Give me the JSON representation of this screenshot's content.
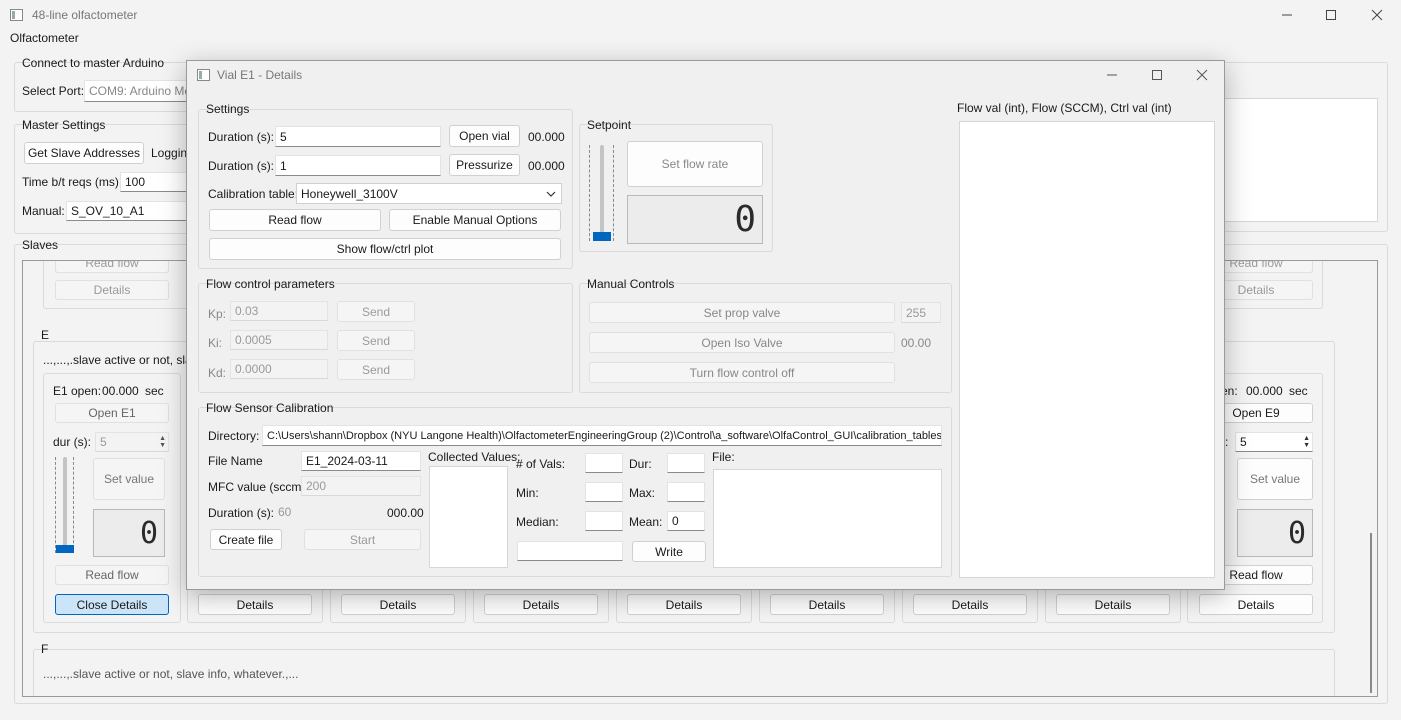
{
  "main_window": {
    "title": "48-line olfactometer",
    "menu": "Olfactometer",
    "connect": {
      "title": "Connect to master Arduino",
      "port_label": "Select Port:",
      "port_value": "COM9: Arduino Mega"
    },
    "master_settings": {
      "title": "Master Settings",
      "get_slave_button": "Get Slave Addresses",
      "logging_label": "Logging",
      "time_label": "Time b/t reqs (ms):",
      "time_value": "100",
      "manual_label": "Manual:",
      "manual_value": "S_OV_10_A1"
    },
    "slaves": {
      "title": "Slaves",
      "top_row": {
        "read_flow": "Read flow",
        "details": "Details"
      },
      "e_group": {
        "title": "E",
        "info": "...,...,.slave active or not, sla",
        "vial_e1": {
          "open_label": "E1 open:",
          "open_value": "00.000",
          "open_unit": "sec",
          "open_button": "Open E1",
          "dur_label": "dur (s):",
          "dur_value": "5",
          "set_value": "Set value",
          "lcd": "0",
          "read_flow": "Read flow",
          "close_details": "Close Details"
        },
        "vial_e9": {
          "open_label": "en:",
          "open_value": "00.000",
          "open_unit": "sec",
          "open_button": "Open E9",
          "dur_label": "):",
          "dur_value": "5",
          "set_value": "Set value",
          "lcd": "0",
          "read_flow": "Read flow",
          "details": "Details"
        },
        "details_buttons": [
          "Details",
          "Details",
          "Details",
          "Details",
          "Details",
          "Details",
          "Details"
        ]
      },
      "f_group": {
        "title": "F",
        "info": "...,...,.slave active or not, slave info, whatever.,..."
      }
    }
  },
  "dialog": {
    "title": "Vial E1 - Details",
    "settings": {
      "title": "Settings",
      "duration_label_1": "Duration (s):",
      "duration_value_1": "5",
      "open_vial_button": "Open vial",
      "open_vial_time": "00.000",
      "duration_label_2": "Duration (s):",
      "duration_value_2": "1",
      "pressurize_button": "Pressurize",
      "pressurize_time": "00.000",
      "calibration_label": "Calibration table:",
      "calibration_value": "Honeywell_3100V",
      "read_flow_button": "Read flow",
      "enable_manual_button": "Enable Manual Options",
      "show_plot_button": "Show flow/ctrl plot"
    },
    "setpoint": {
      "title": "Setpoint",
      "set_flow_button": "Set flow rate",
      "lcd": "0"
    },
    "plot": {
      "title": "Flow val (int), Flow (SCCM), Ctrl val (int)"
    },
    "flow_control": {
      "title": "Flow control parameters",
      "kp_label": "Kp:",
      "kp_value": "0.03",
      "ki_label": "Ki:",
      "ki_value": "0.0005",
      "kd_label": "Kd:",
      "kd_value": "0.0000",
      "send": "Send"
    },
    "manual_controls": {
      "title": "Manual Controls",
      "set_prop_button": "Set prop valve",
      "prop_value": "255",
      "open_iso_button": "Open Iso Valve",
      "iso_value": "00.00",
      "turn_off_button": "Turn flow control off"
    },
    "calibration": {
      "title": "Flow Sensor Calibration",
      "directory_label": "Directory:",
      "directory_value": "C:\\Users\\shann\\Dropbox (NYU Langone Health)\\OlfactometerEngineeringGroup (2)\\Control\\a_software\\OlfaControl_GUI\\calibration_tables",
      "file_name_label": "File Name",
      "file_name_value": "E1_2024-03-11",
      "mfc_label": "MFC value (sccm):",
      "mfc_value": "200",
      "duration_label": "Duration (s):",
      "duration_value": "60",
      "duration_time": "000.00",
      "create_file": "Create file",
      "start": "Start",
      "collected_label": "Collected Values:",
      "num_vals_label": "# of Vals:",
      "dur_label": "Dur:",
      "min_label": "Min:",
      "max_label": "Max:",
      "median_label": "Median:",
      "mean_label": "Mean:",
      "mean_value": "0",
      "write": "Write",
      "file_label": "File:"
    }
  },
  "colors": {
    "accent": "#0067c0",
    "window_bg": "#f3f3f3",
    "dialog_bg": "#f0f0f0"
  }
}
